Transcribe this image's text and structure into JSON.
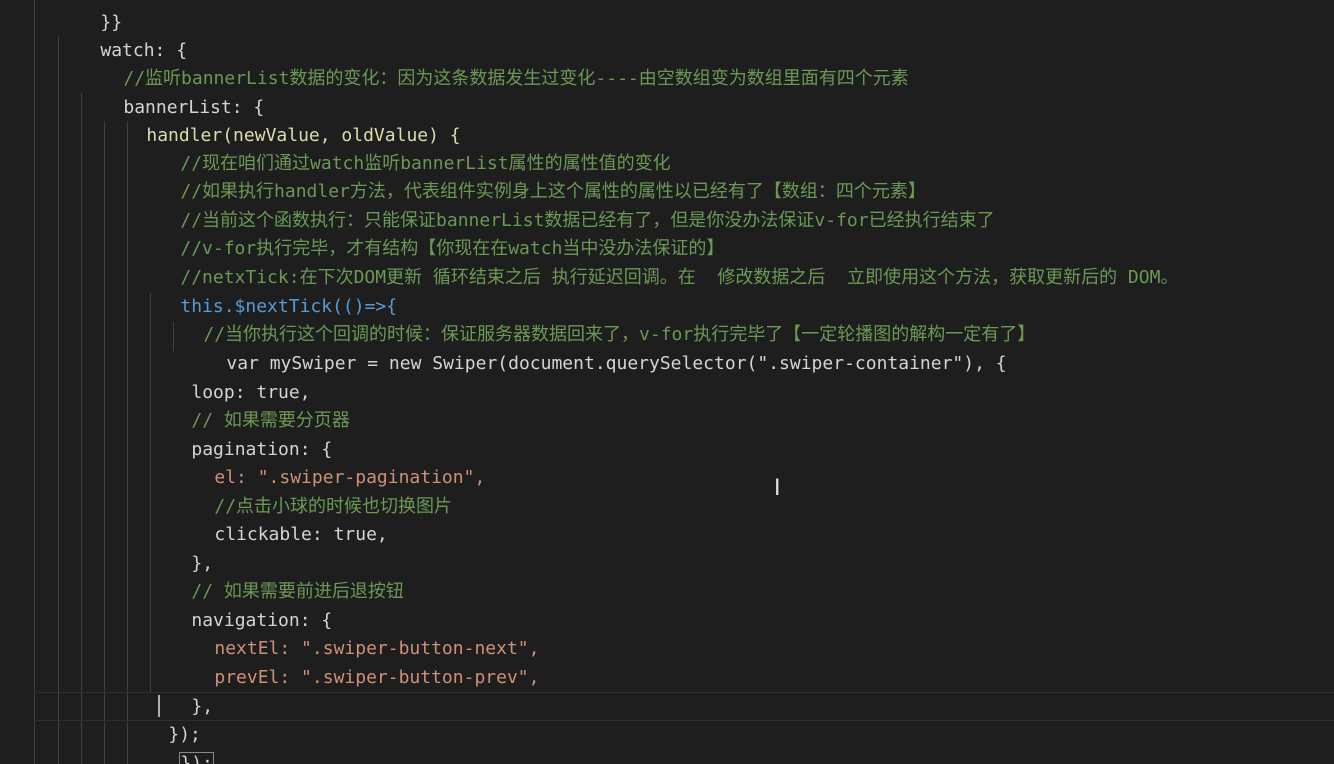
{
  "editor": {
    "lines": [
      "}}",
      "watch: {",
      "//监听bannerList数据的变化：因为这条数据发生过变化----由空数组变为数组里面有四个元素",
      "bannerList: {",
      "handler(newValue, oldValue) {",
      "//现在咱们通过watch监听bannerList属性的属性值的变化",
      "//如果执行handler方法，代表组件实例身上这个属性的属性以已经有了【数组：四个元素】",
      "//当前这个函数执行：只能保证bannerList数据已经有了，但是你没办法保证v-for已经执行结束了",
      "//v-for执行完毕，才有结构【你现在在watch当中没办法保证的】",
      "//netxTick:在下次DOM更新 循环结束之后 执行延迟回调。在  修改数据之后  立即使用这个方法，获取更新后的 DOM。",
      "this.$nextTick(()=>{",
      "//当你执行这个回调的时候：保证服务器数据回来了，v-for执行完毕了【一定轮播图的解构一定有了】",
      "var mySwiper = new Swiper(document.querySelector(\".swiper-container\"), {",
      "loop: true,",
      "// 如果需要分页器",
      "pagination: {",
      "el: \".swiper-pagination\",",
      "//点击小球的时候也切换图片",
      "clickable: true,",
      "},",
      "// 如果需要前进后退按钮",
      "navigation: {",
      "nextEl: \".swiper-button-next\",",
      "prevEl: \".swiper-button-prev\",",
      "},",
      "});",
      "});"
    ]
  }
}
